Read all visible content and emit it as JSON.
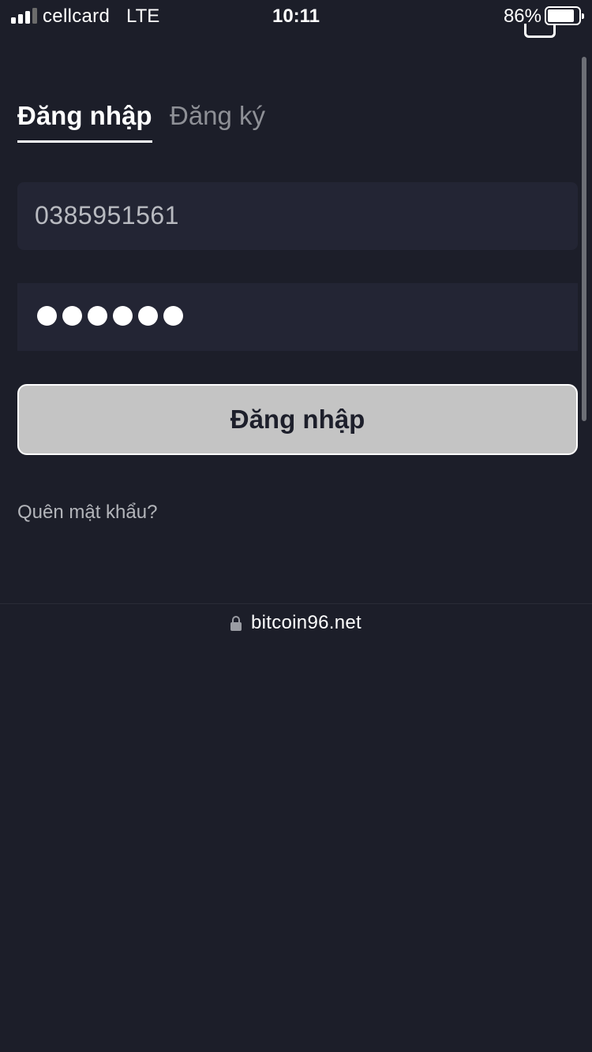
{
  "status_bar": {
    "carrier": "cellcard",
    "network": "LTE",
    "time": "10:11",
    "battery_percent": "86%",
    "battery_level": 0.86,
    "signal_bars": 3,
    "signal_bars_total": 4
  },
  "tabs": [
    {
      "label": "Đăng nhập",
      "active": true
    },
    {
      "label": "Đăng ký",
      "active": false
    }
  ],
  "form": {
    "phone_value": "0385951561",
    "password_mask_count": 6,
    "submit_label": "Đăng nhập",
    "forgot_password_label": "Quên mật khẩu?"
  },
  "browser": {
    "url": "bitcoin96.net",
    "secure_icon": "lock-icon"
  },
  "colors": {
    "background": "#1c1e29",
    "input_background": "#232534",
    "button_background": "#c4c4c4",
    "muted_text": "#8e9096"
  }
}
